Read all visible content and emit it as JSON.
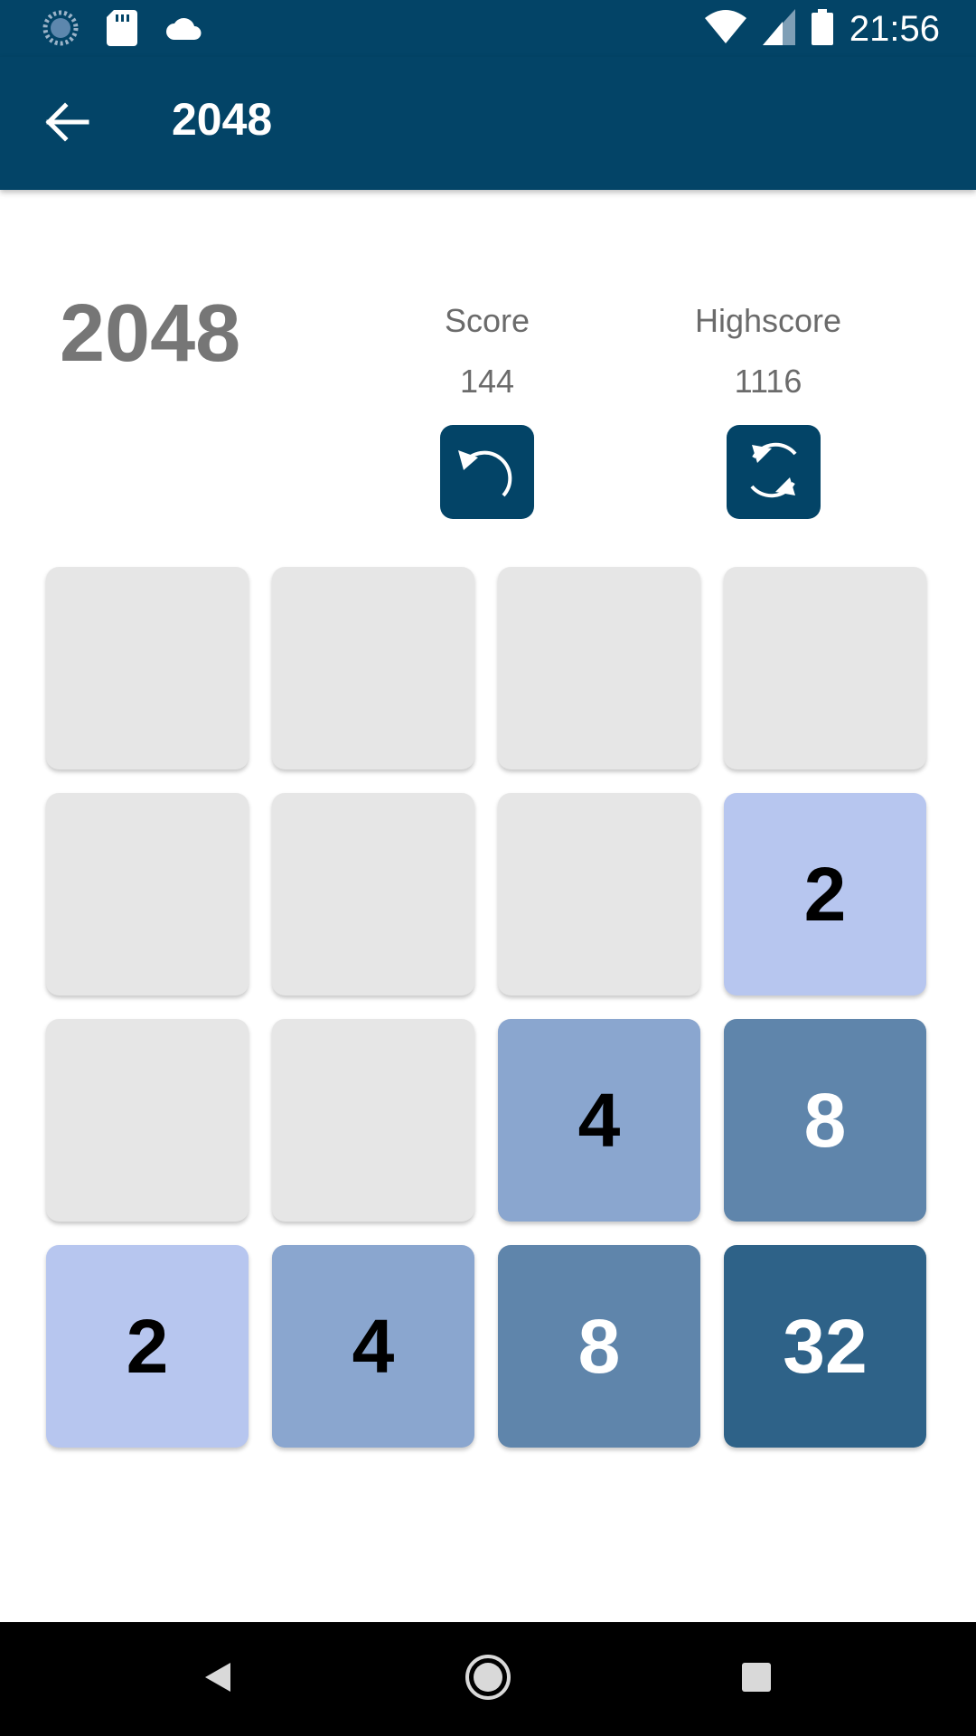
{
  "status_bar": {
    "time": "21:56",
    "left_icons": [
      "spinner-icon",
      "sd-card-icon",
      "cloud-icon"
    ],
    "right_icons": [
      "wifi-icon",
      "signal-icon",
      "battery-icon"
    ]
  },
  "app_bar": {
    "title": "2048",
    "back_icon": "arrow-back-icon"
  },
  "game": {
    "title": "2048",
    "score_label": "Score",
    "score_value": "144",
    "highscore_label": "Highscore",
    "highscore_value": "1116",
    "undo_icon": "undo-icon",
    "restart_icon": "restart-icon",
    "board": [
      [
        0,
        0,
        0,
        0
      ],
      [
        0,
        0,
        0,
        2
      ],
      [
        0,
        0,
        4,
        8
      ],
      [
        2,
        4,
        8,
        32
      ]
    ]
  },
  "colors": {
    "primary": "#034467",
    "empty_tile": "#e6e6e6",
    "tile_2": "#b7c6ef",
    "tile_4": "#8aa6cf",
    "tile_8": "#5f85ab",
    "tile_32": "#2e6288",
    "text_muted": "#767676"
  },
  "nav_bar": {
    "icons": [
      "nav-back-icon",
      "nav-home-icon",
      "nav-recents-icon"
    ]
  }
}
